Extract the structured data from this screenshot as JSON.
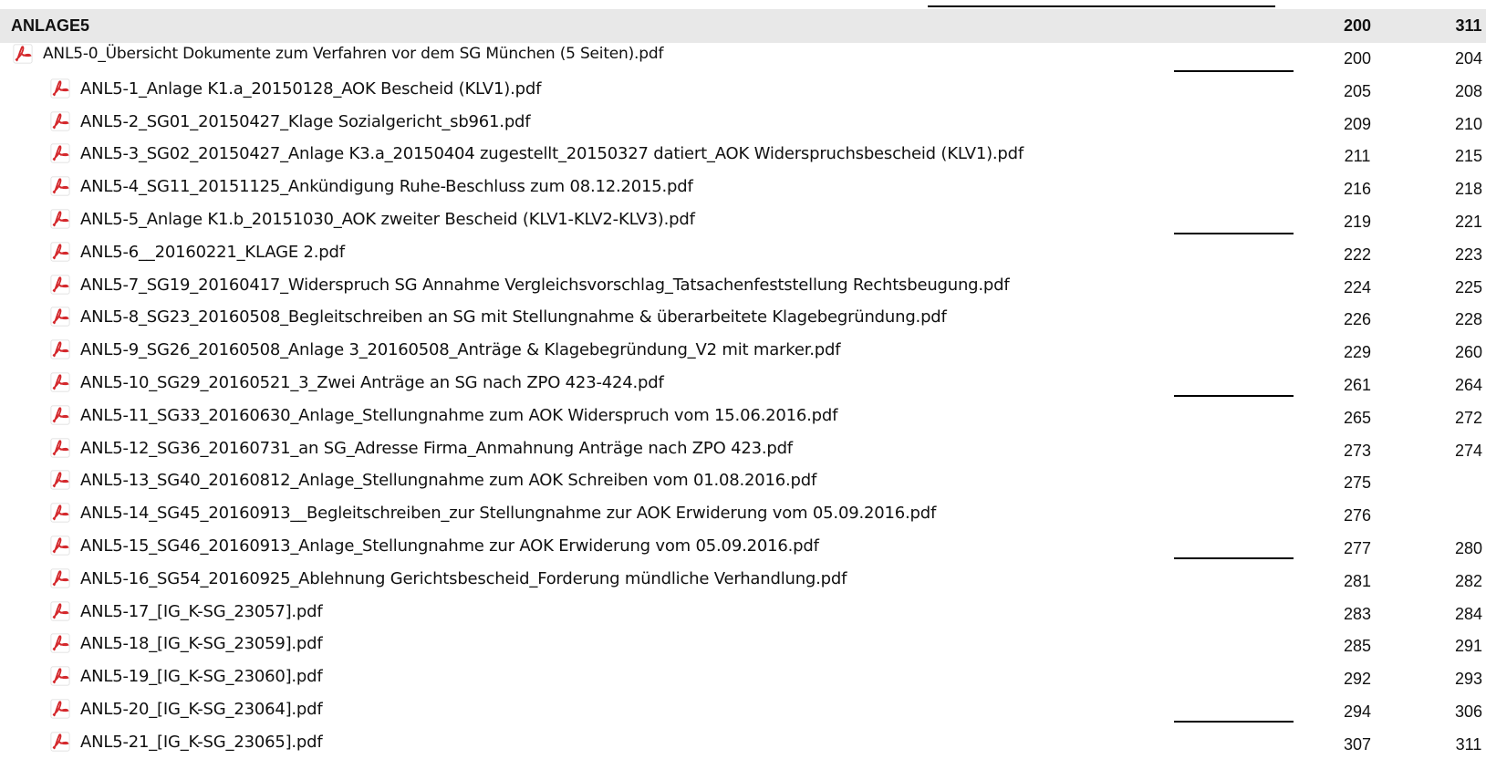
{
  "header": {
    "title": "ANLAGE5",
    "start": "200",
    "end": "311"
  },
  "rows": [
    {
      "name": "ANL5-0_Übersicht Dokumente zum Verfahren vor dem SG München (5 Seiten).pdf",
      "start": "200",
      "end": "204"
    },
    {
      "name": "ANL5-1_Anlage K1.a_20150128_AOK Bescheid (KLV1).pdf",
      "start": "205",
      "end": "208"
    },
    {
      "name": "ANL5-2_SG01_20150427_Klage Sozialgericht_sb961.pdf",
      "start": "209",
      "end": "210"
    },
    {
      "name": "ANL5-3_SG02_20150427_Anlage K3.a_20150404 zugestellt_20150327 datiert_AOK Widerspruchsbescheid (KLV1).pdf",
      "start": "211",
      "end": "215"
    },
    {
      "name": "ANL5-4_SG11_20151125_Ankündigung Ruhe-Beschluss zum 08.12.2015.pdf",
      "start": "216",
      "end": "218"
    },
    {
      "name": "ANL5-5_Anlage K1.b_20151030_AOK zweiter Bescheid (KLV1-KLV2-KLV3).pdf",
      "start": "219",
      "end": "221"
    },
    {
      "name": "ANL5-6__20160221_KLAGE 2.pdf",
      "start": "222",
      "end": "223"
    },
    {
      "name": "ANL5-7_SG19_20160417_Widerspruch SG Annahme Vergleichsvorschlag_Tatsachenfeststellung Rechtsbeugung.pdf",
      "start": "224",
      "end": "225"
    },
    {
      "name": "ANL5-8_SG23_20160508_Begleitschreiben an SG mit Stellungnahme & überarbeitete Klagebegründung.pdf",
      "start": "226",
      "end": "228"
    },
    {
      "name": "ANL5-9_SG26_20160508_Anlage 3_20160508_Anträge & Klagebegründung_V2 mit marker.pdf",
      "start": "229",
      "end": "260"
    },
    {
      "name": "ANL5-10_SG29_20160521_3_Zwei Anträge an SG nach ZPO 423-424.pdf",
      "start": "261",
      "end": "264"
    },
    {
      "name": "ANL5-11_SG33_20160630_Anlage_Stellungnahme zum AOK Widerspruch vom 15.06.2016.pdf",
      "start": "265",
      "end": "272"
    },
    {
      "name": "ANL5-12_SG36_20160731_an SG_Adresse Firma_Anmahnung Anträge nach ZPO 423.pdf",
      "start": "273",
      "end": "274"
    },
    {
      "name": "ANL5-13_SG40_20160812_Anlage_Stellungnahme zum AOK Schreiben vom 01.08.2016.pdf",
      "start": "275",
      "end": ""
    },
    {
      "name": "ANL5-14_SG45_20160913__Begleitschreiben_zur Stellungnahme zur AOK Erwiderung vom 05.09.2016.pdf",
      "start": "276",
      "end": ""
    },
    {
      "name": "ANL5-15_SG46_20160913_Anlage_Stellungnahme zur AOK Erwiderung vom 05.09.2016.pdf",
      "start": "277",
      "end": "280"
    },
    {
      "name": "ANL5-16_SG54_20160925_Ablehnung Gerichtsbescheid_Forderung mündliche Verhandlung.pdf",
      "start": "281",
      "end": "282"
    },
    {
      "name": "ANL5-17_[IG_K-SG_23057].pdf",
      "start": "283",
      "end": "284"
    },
    {
      "name": "ANL5-18_[IG_K-SG_23059].pdf",
      "start": "285",
      "end": "291"
    },
    {
      "name": "ANL5-19_[IG_K-SG_23060].pdf",
      "start": "292",
      "end": "293"
    },
    {
      "name": "ANL5-20_[IG_K-SG_23064].pdf",
      "start": "294",
      "end": "306"
    },
    {
      "name": "ANL5-21_[IG_K-SG_23065].pdf",
      "start": "307",
      "end": "311"
    }
  ],
  "icons": {
    "file": "pdf-file-icon",
    "color": "#d4282c"
  }
}
